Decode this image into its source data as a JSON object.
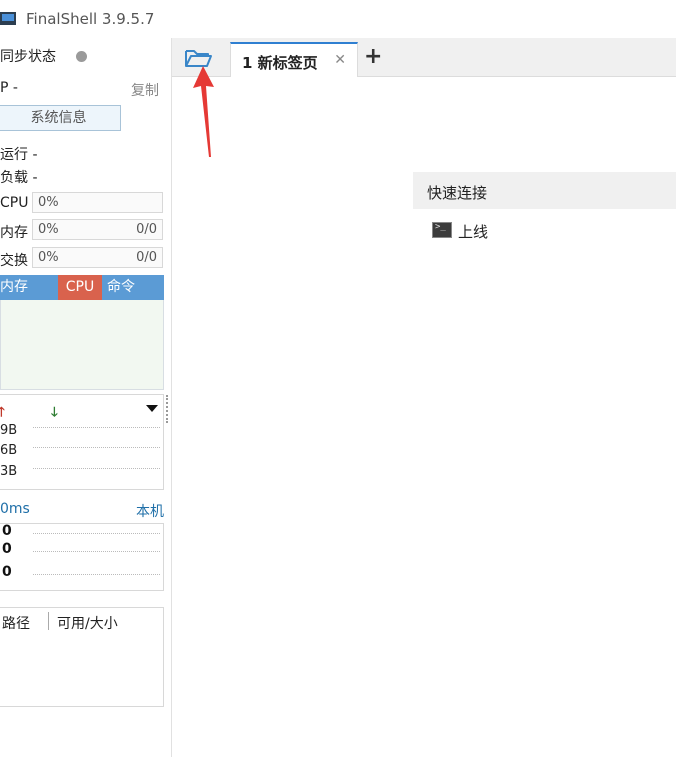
{
  "window": {
    "title": "FinalShell 3.9.5.7"
  },
  "left_panel": {
    "sync_status_label": "同步状态",
    "ip_label": "P -",
    "copy_label": "复制",
    "system_info_button": "系统信息",
    "uptime_label": "运行 -",
    "load_label": "负载 -",
    "cpu": {
      "label": "CPU",
      "value": "0%"
    },
    "memory": {
      "label": "内存",
      "value": "0%",
      "count": "0/0"
    },
    "swap": {
      "label": "交换",
      "value": "0%",
      "count": "0/0"
    },
    "process_tabs": [
      "内存",
      "CPU",
      "命令"
    ],
    "network": {
      "labels": [
        "9B",
        "6B",
        "3B"
      ]
    },
    "ping": {
      "latency": "0ms",
      "host": "本机",
      "values": [
        "0",
        "0",
        "0"
      ]
    },
    "filesystem": {
      "columns": [
        "路径",
        "可用/大小"
      ]
    }
  },
  "tabbar": {
    "active_tab_label": "1 新标签页",
    "close_symbol": "✕",
    "add_symbol": "+"
  },
  "quick_connect": {
    "title": "快速连接",
    "items": [
      {
        "label": "上线"
      }
    ]
  },
  "colors": {
    "accent_blue": "#5b9bd5",
    "cpu_tab_red": "#d9624d",
    "tab_underline": "#2f7fd1",
    "annotation_red": "#e53935"
  }
}
